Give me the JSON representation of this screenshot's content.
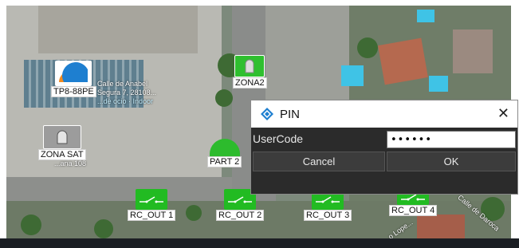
{
  "map": {
    "zones": [
      {
        "label": "TP8-88PE"
      },
      {
        "label": "ZONA2"
      },
      {
        "label": "ZONA SAT"
      }
    ],
    "partition": {
      "label": "PART 2"
    },
    "outputs": [
      {
        "label": "RC_OUT 1"
      },
      {
        "label": "RC_OUT 2"
      },
      {
        "label": "RC_OUT 3"
      },
      {
        "label": "RC_OUT 4"
      }
    ],
    "map_texts": {
      "address_line1": "Calle de Anabel",
      "address_line2": "Segura 7, 28108...",
      "address_line3": "...de ocio · Indoor",
      "place": "...ana 108",
      "street": "Calle de Daroca",
      "street2": "...o Lope..."
    }
  },
  "dialog": {
    "title": "PIN",
    "close_glyph": "✕",
    "usercode_label": "UserCode",
    "usercode_value": "••••••",
    "cancel_label": "Cancel",
    "ok_label": "OK"
  },
  "colors": {
    "zone_green": "#2fbf2f",
    "output_green": "#22bb22",
    "dialog_bg": "#2b2b2b",
    "accent_blue": "#1e7fd0"
  }
}
